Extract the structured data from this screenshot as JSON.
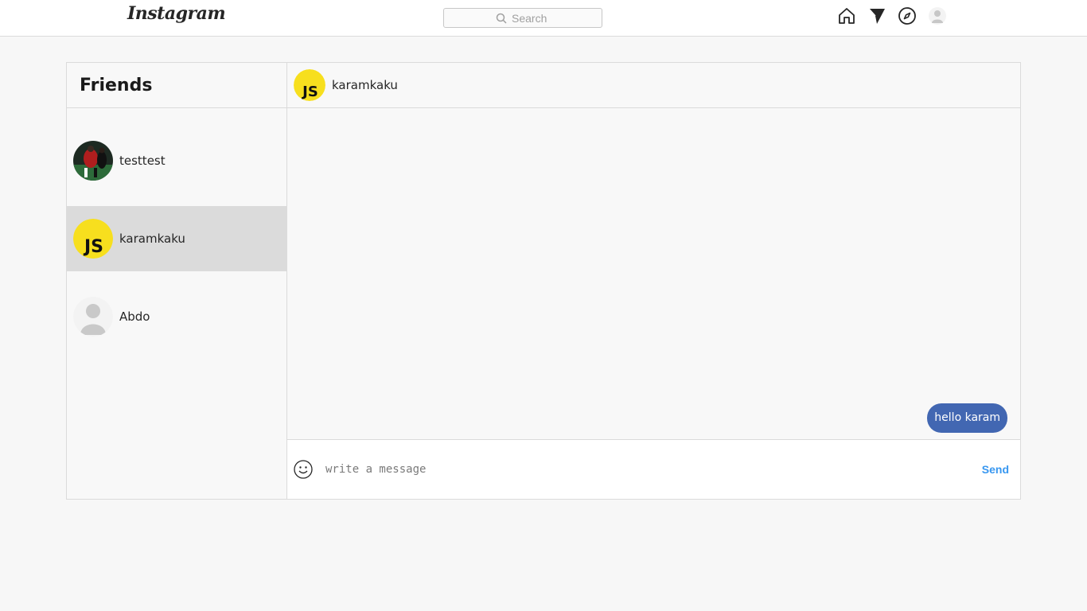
{
  "header": {
    "logo_text": "Instagram",
    "search_placeholder": "Search",
    "icons": [
      "home-icon",
      "direct-send-icon",
      "explore-compass-icon",
      "profile-avatar-icon"
    ]
  },
  "sidebar": {
    "title": "Friends",
    "friends": [
      {
        "name": "testtest",
        "avatar": "photo-avatar",
        "active": false
      },
      {
        "name": "karamkaku",
        "avatar": "js-logo-avatar",
        "active": true
      },
      {
        "name": "Abdo",
        "avatar": "default-person-avatar",
        "active": false
      }
    ]
  },
  "chat": {
    "contact_name": "karamkaku",
    "messages": [
      {
        "text": "hello karam",
        "from": "me"
      }
    ],
    "composer": {
      "placeholder": "write a message",
      "send_label": "Send"
    }
  },
  "colors": {
    "accent": "#3897f0",
    "bubble": "#4267b2",
    "active_row": "#dbdbdb",
    "js_yellow": "#f7df1e"
  }
}
